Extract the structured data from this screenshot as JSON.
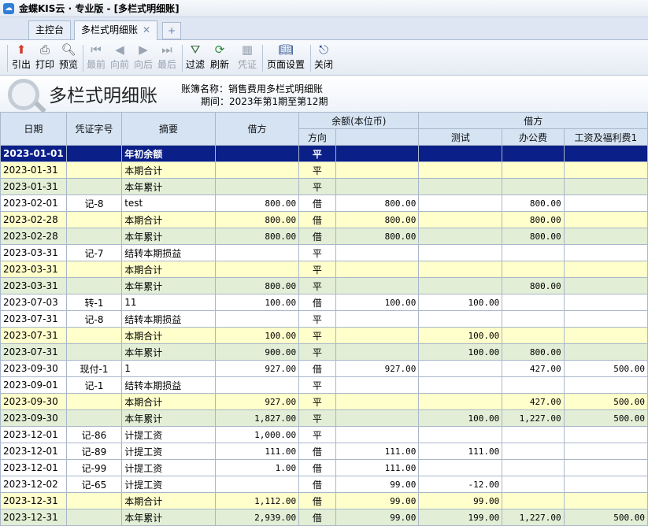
{
  "app": {
    "title": "金蝶KIS云 · 专业版 - [多栏式明细账]"
  },
  "tabs": [
    {
      "label": "主控台"
    },
    {
      "label": "多栏式明细账"
    }
  ],
  "toolbar": {
    "export": "引出",
    "print": "打印",
    "preview": "预览",
    "first": "最前",
    "prev": "向前",
    "next": "向后",
    "last": "最后",
    "filter": "过滤",
    "refresh": "刷新",
    "voucher": "凭证",
    "page_setup": "页面设置",
    "close": "关闭"
  },
  "report": {
    "title": "多栏式明细账",
    "book_name": "账簿名称：销售费用多栏式明细账",
    "period": "期间：2023年第1期至第12期"
  },
  "table": {
    "headers": {
      "date": "日期",
      "voucher": "凭证字号",
      "summary": "摘要",
      "debit": "借方",
      "balance": "余额(本位币)",
      "direction": "方向",
      "debit_group": "借方",
      "test": "测试",
      "office": "办公费",
      "salary": "工资及福利费1"
    },
    "rows": [
      {
        "style": "n",
        "date": "2023-01-01",
        "voucher": "",
        "summary": "年初余额",
        "debit": "",
        "dir": "平",
        "balance": "",
        "test": "",
        "office": "",
        "salary": ""
      },
      {
        "style": "y",
        "date": "2023-01-31",
        "voucher": "",
        "summary": "本期合计",
        "debit": "",
        "dir": "平",
        "balance": "",
        "test": "",
        "office": "",
        "salary": ""
      },
      {
        "style": "g",
        "date": "2023-01-31",
        "voucher": "",
        "summary": "本年累计",
        "debit": "",
        "dir": "平",
        "balance": "",
        "test": "",
        "office": "",
        "salary": ""
      },
      {
        "style": "w",
        "date": "2023-02-01",
        "voucher": "记-8",
        "summary": "test",
        "debit": "800.00",
        "dir": "借",
        "balance": "800.00",
        "test": "",
        "office": "800.00",
        "salary": ""
      },
      {
        "style": "y",
        "date": "2023-02-28",
        "voucher": "",
        "summary": "本期合计",
        "debit": "800.00",
        "dir": "借",
        "balance": "800.00",
        "test": "",
        "office": "800.00",
        "salary": ""
      },
      {
        "style": "g",
        "date": "2023-02-28",
        "voucher": "",
        "summary": "本年累计",
        "debit": "800.00",
        "dir": "借",
        "balance": "800.00",
        "test": "",
        "office": "800.00",
        "salary": ""
      },
      {
        "style": "w",
        "date": "2023-03-31",
        "voucher": "记-7",
        "summary": "结转本期损益",
        "debit": "",
        "dir": "平",
        "balance": "",
        "test": "",
        "office": "",
        "salary": ""
      },
      {
        "style": "y",
        "date": "2023-03-31",
        "voucher": "",
        "summary": "本期合计",
        "debit": "",
        "dir": "平",
        "balance": "",
        "test": "",
        "office": "",
        "salary": ""
      },
      {
        "style": "g",
        "date": "2023-03-31",
        "voucher": "",
        "summary": "本年累计",
        "debit": "800.00",
        "dir": "平",
        "balance": "",
        "test": "",
        "office": "800.00",
        "salary": ""
      },
      {
        "style": "w",
        "date": "2023-07-03",
        "voucher": "转-1",
        "summary": "11",
        "debit": "100.00",
        "dir": "借",
        "balance": "100.00",
        "test": "100.00",
        "office": "",
        "salary": ""
      },
      {
        "style": "w",
        "date": "2023-07-31",
        "voucher": "记-8",
        "summary": "结转本期损益",
        "debit": "",
        "dir": "平",
        "balance": "",
        "test": "",
        "office": "",
        "salary": ""
      },
      {
        "style": "y",
        "date": "2023-07-31",
        "voucher": "",
        "summary": "本期合计",
        "debit": "100.00",
        "dir": "平",
        "balance": "",
        "test": "100.00",
        "office": "",
        "salary": ""
      },
      {
        "style": "g",
        "date": "2023-07-31",
        "voucher": "",
        "summary": "本年累计",
        "debit": "900.00",
        "dir": "平",
        "balance": "",
        "test": "100.00",
        "office": "800.00",
        "salary": ""
      },
      {
        "style": "w",
        "date": "2023-09-30",
        "voucher": "现付-1",
        "summary": "1",
        "debit": "927.00",
        "dir": "借",
        "balance": "927.00",
        "test": "",
        "office": "427.00",
        "salary": "500.00"
      },
      {
        "style": "w",
        "date": "2023-09-01",
        "voucher": "记-1",
        "summary": "结转本期损益",
        "debit": "",
        "dir": "平",
        "balance": "",
        "test": "",
        "office": "",
        "salary": ""
      },
      {
        "style": "y",
        "date": "2023-09-30",
        "voucher": "",
        "summary": "本期合计",
        "debit": "927.00",
        "dir": "平",
        "balance": "",
        "test": "",
        "office": "427.00",
        "salary": "500.00"
      },
      {
        "style": "g",
        "date": "2023-09-30",
        "voucher": "",
        "summary": "本年累计",
        "debit": "1,827.00",
        "dir": "平",
        "balance": "",
        "test": "100.00",
        "office": "1,227.00",
        "salary": "500.00"
      },
      {
        "style": "w",
        "date": "2023-12-01",
        "voucher": "记-86",
        "summary": "计提工资",
        "debit": "1,000.00",
        "dir": "平",
        "balance": "",
        "test": "",
        "office": "",
        "salary": ""
      },
      {
        "style": "w",
        "date": "2023-12-01",
        "voucher": "记-89",
        "summary": "计提工资",
        "debit": "111.00",
        "dir": "借",
        "balance": "111.00",
        "test": "111.00",
        "office": "",
        "salary": ""
      },
      {
        "style": "w",
        "date": "2023-12-01",
        "voucher": "记-99",
        "summary": "计提工资",
        "debit": "1.00",
        "dir": "借",
        "balance": "111.00",
        "test": "",
        "office": "",
        "salary": ""
      },
      {
        "style": "w",
        "date": "2023-12-02",
        "voucher": "记-65",
        "summary": "计提工资",
        "debit": "",
        "dir": "借",
        "balance": "99.00",
        "test": "-12.00",
        "office": "",
        "salary": ""
      },
      {
        "style": "y",
        "date": "2023-12-31",
        "voucher": "",
        "summary": "本期合计",
        "debit": "1,112.00",
        "dir": "借",
        "balance": "99.00",
        "test": "99.00",
        "office": "",
        "salary": ""
      },
      {
        "style": "g",
        "date": "2023-12-31",
        "voucher": "",
        "summary": "本年累计",
        "debit": "2,939.00",
        "dir": "借",
        "balance": "99.00",
        "test": "199.00",
        "office": "1,227.00",
        "salary": "500.00"
      }
    ]
  }
}
